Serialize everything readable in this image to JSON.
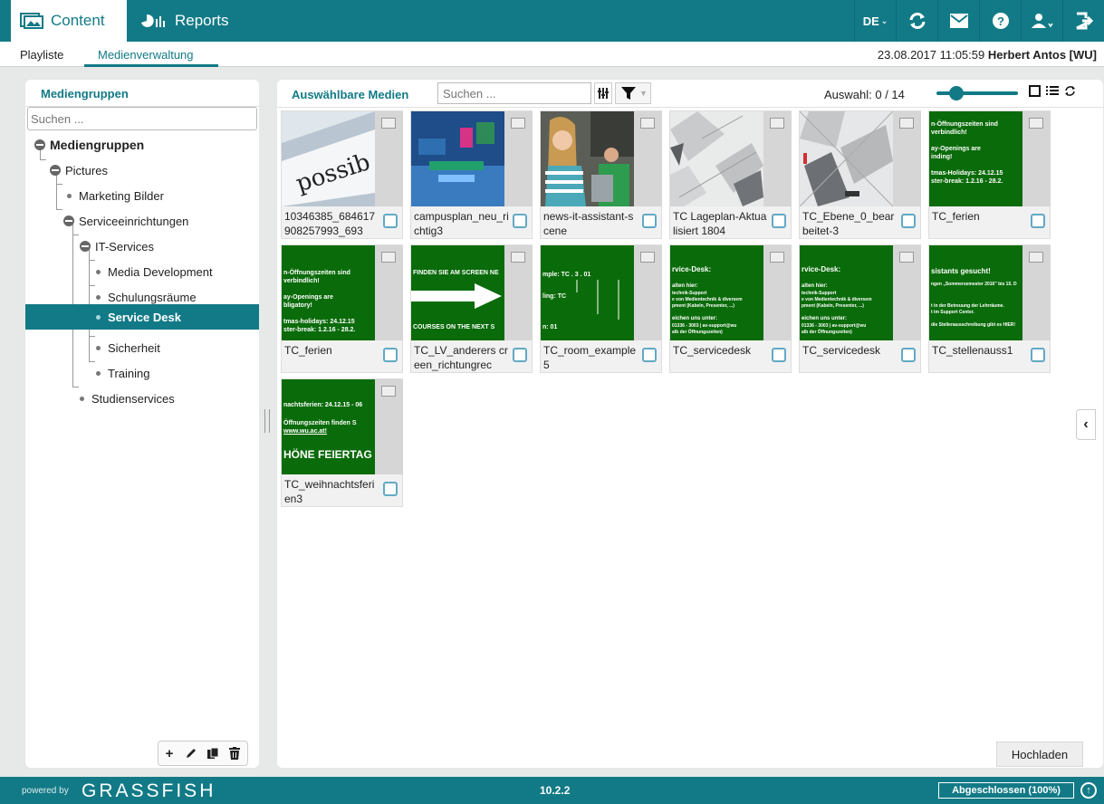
{
  "header": {
    "tabs": [
      {
        "label": "Content",
        "icon": "media-icon"
      },
      {
        "label": "Reports",
        "icon": "chart-icon"
      }
    ],
    "language": "DE"
  },
  "subnav": {
    "tabs": [
      "Playliste",
      "Medienverwaltung"
    ],
    "datetime": "23.08.2017 11:05:59",
    "user": "Herbert Antos [WU]"
  },
  "left": {
    "title": "Mediengruppen",
    "search_placeholder": "Suchen ...",
    "tree": {
      "root": "Mediengruppen",
      "pictures": "Pictures",
      "marketing": "Marketing Bilder",
      "service": "Serviceeinrichtungen",
      "it": "IT-Services",
      "media_dev": "Media Development",
      "schulung": "Schulungsräume",
      "servicedesk": "Service Desk",
      "sicherheit": "Sicherheit",
      "training": "Training",
      "studien": "Studienservices"
    }
  },
  "right": {
    "title": "Auswählbare Medien",
    "search_placeholder": "Suchen ...",
    "selection": "Auswahl: 0 / 14",
    "slider_value": 0.2,
    "tiles": [
      {
        "label": "10346385_684617908257993_693"
      },
      {
        "label": "campusplan_neu_richtig3"
      },
      {
        "label": "news-it-assistant-scene"
      },
      {
        "label": "TC Lageplan-Aktualisiert 1804"
      },
      {
        "label": "TC_Ebene_0_bearbeitet-3"
      },
      {
        "label": "TC_ferien"
      },
      {
        "label": "TC_ferien"
      },
      {
        "label": "TC_LV_anderers creen_richtungrec"
      },
      {
        "label": "TC_room_example5"
      },
      {
        "label": "TC_servicedesk"
      },
      {
        "label": "TC_servicedesk"
      },
      {
        "label": "TC_stellenauss1"
      },
      {
        "label": "TC_weihnachtsferien3"
      }
    ],
    "thumb_text": {
      "ferien": [
        "n-Öffnungszeiten sind",
        "verbindlich!",
        "",
        "ay-Openings are",
        "inding!",
        "",
        "tmas-Holidays: 24.12.15",
        "ster-break: 1.2.16 - 28.2."
      ],
      "ferien2": [
        "n-Öffnungszeiten sind",
        "verbindlich!",
        "",
        "ay-Openings are",
        "bligatory!",
        "",
        "tmas-holidays: 24.12.15",
        "ster-break: 1.2.16 - 28.2."
      ],
      "lv_top": "FINDEN SIE AM SCREEN NE",
      "lv_bottom": "COURSES ON THE NEXT S",
      "room": [
        "mple:   TC . 3 . 01",
        "",
        "ling:   TC",
        "",
        "",
        "n:              01"
      ],
      "servicedesk": [
        "rvice-Desk:",
        "",
        "alten hier:",
        "technik-Support",
        "e von Medientechnik & diversem",
        "pment (Kabeln, Presenter, ...)",
        "",
        "eichen uns unter:",
        "01336 - 3003 | av-support@wu",
        "alb der Öffnungszeiten)"
      ],
      "stellen": [
        "sistants gesucht!",
        "",
        "ngen „Sommersemester 2016\" bis 15. D",
        "",
        "t in der Betreuung der Lehrräume.",
        "t im Support Center.",
        "",
        "die Stellenausschreibung gibt es HIER!"
      ],
      "weihn": [
        "nachtsferien: 24.12.15 - 06",
        "",
        "Öffnungszeiten finden S",
        "www.wu.ac.at!",
        "",
        "HÖNE FEIERTAG"
      ]
    },
    "upload_label": "Hochladen"
  },
  "footer": {
    "powered": "powered by",
    "brand": "GRASSFISH",
    "version": "10.2.2",
    "progress": "Abgeschlossen (100%)"
  },
  "colors": {
    "primary": "#127a86",
    "thumb_green": "#0a6b0a"
  }
}
